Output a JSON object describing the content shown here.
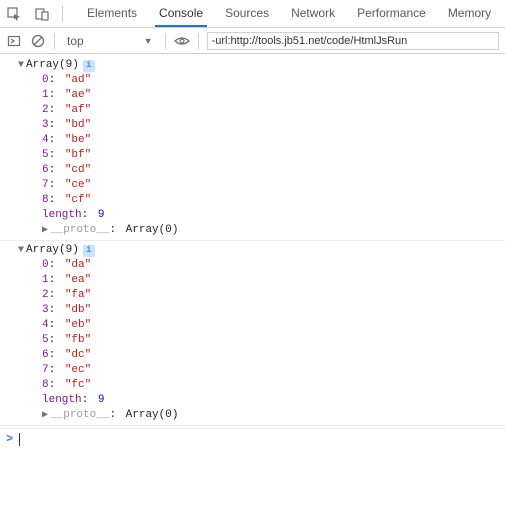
{
  "tabs": {
    "elements": "Elements",
    "console": "Console",
    "sources": "Sources",
    "network": "Network",
    "performance": "Performance",
    "memory": "Memory"
  },
  "subbar": {
    "context": "top",
    "filter_value": "-url:http://tools.jb51.net/code/HtmlJsRun"
  },
  "logs": [
    {
      "header": "Array(9)",
      "info_glyph": "i",
      "entries": [
        {
          "index": "0",
          "value": "\"ad\""
        },
        {
          "index": "1",
          "value": "\"ae\""
        },
        {
          "index": "2",
          "value": "\"af\""
        },
        {
          "index": "3",
          "value": "\"bd\""
        },
        {
          "index": "4",
          "value": "\"be\""
        },
        {
          "index": "5",
          "value": "\"bf\""
        },
        {
          "index": "6",
          "value": "\"cd\""
        },
        {
          "index": "7",
          "value": "\"ce\""
        },
        {
          "index": "8",
          "value": "\"cf\""
        }
      ],
      "length_key": "length",
      "length_val": "9",
      "proto_key": "__proto__",
      "proto_val": "Array(0)"
    },
    {
      "header": "Array(9)",
      "info_glyph": "i",
      "entries": [
        {
          "index": "0",
          "value": "\"da\""
        },
        {
          "index": "1",
          "value": "\"ea\""
        },
        {
          "index": "2",
          "value": "\"fa\""
        },
        {
          "index": "3",
          "value": "\"db\""
        },
        {
          "index": "4",
          "value": "\"eb\""
        },
        {
          "index": "5",
          "value": "\"fb\""
        },
        {
          "index": "6",
          "value": "\"dc\""
        },
        {
          "index": "7",
          "value": "\"ec\""
        },
        {
          "index": "8",
          "value": "\"fc\""
        }
      ],
      "length_key": "length",
      "length_val": "9",
      "proto_key": "__proto__",
      "proto_val": "Array(0)"
    }
  ]
}
